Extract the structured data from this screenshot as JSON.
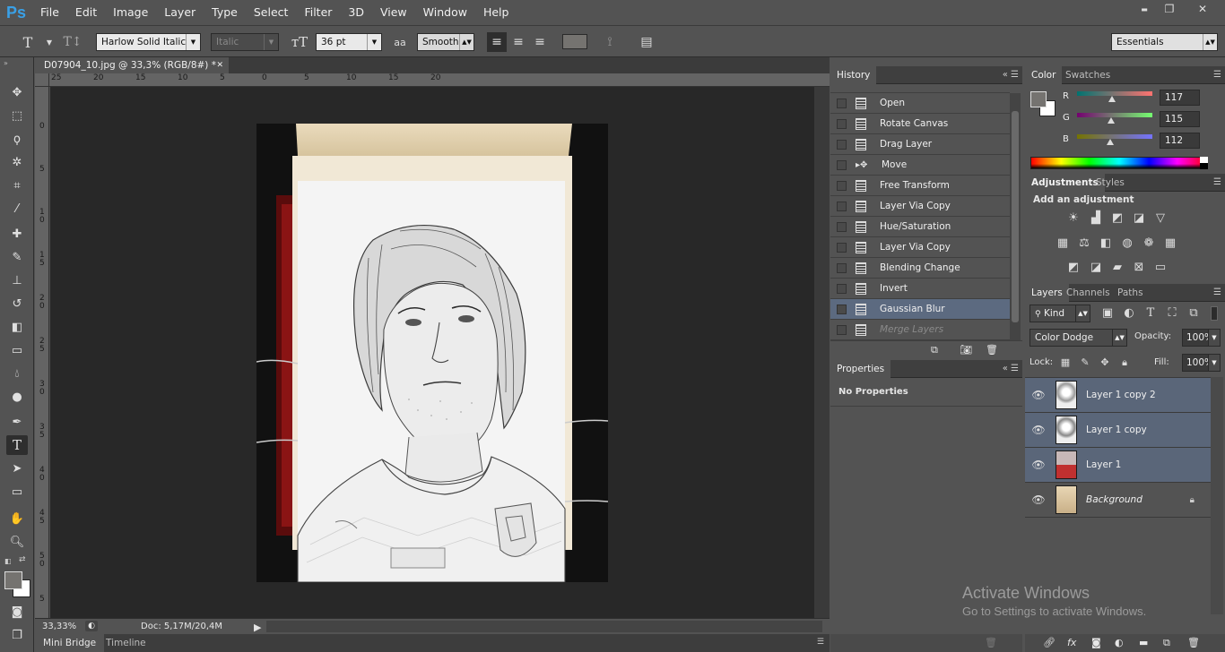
{
  "app": {
    "logo": "Ps"
  },
  "menu": [
    "File",
    "Edit",
    "Image",
    "Layer",
    "Type",
    "Select",
    "Filter",
    "3D",
    "View",
    "Window",
    "Help"
  ],
  "window_controls": {
    "minimize": "▬",
    "restore": "❐",
    "close": "✕"
  },
  "options_bar": {
    "font_family": "Harlow Solid Italic",
    "font_style": "Italic",
    "font_size": "36 pt",
    "aa_label": "aa",
    "antialias": "Smooth",
    "workspace": "Essentials"
  },
  "document": {
    "tab_title": "D07904_10.jpg @ 33,3% (RGB/8#) *",
    "close": "✕"
  },
  "ruler_h": [
    "25",
    "20",
    "15",
    "10",
    "5",
    "0",
    "5",
    "10",
    "15",
    "20"
  ],
  "ruler_v": [
    "0",
    "5",
    "1\n0",
    "1\n5",
    "2\n0",
    "2\n5",
    "3\n0",
    "3\n5",
    "4\n0",
    "4\n5",
    "5\n0",
    "5"
  ],
  "status": {
    "zoom": "33,33%",
    "doc": "Doc: 5,17M/20,4M"
  },
  "bottom_tabs": [
    "Mini Bridge",
    "Timeline"
  ],
  "history": {
    "tab": "History",
    "items": [
      {
        "label": "Open",
        "icon": "doc-icon"
      },
      {
        "label": "Rotate Canvas",
        "icon": "doc-icon"
      },
      {
        "label": "Drag Layer",
        "icon": "doc-icon"
      },
      {
        "label": "Move",
        "icon": "move-icon"
      },
      {
        "label": "Free Transform",
        "icon": "doc-icon"
      },
      {
        "label": "Layer Via Copy",
        "icon": "doc-icon"
      },
      {
        "label": "Hue/Saturation",
        "icon": "doc-icon"
      },
      {
        "label": "Layer Via Copy",
        "icon": "doc-icon"
      },
      {
        "label": "Blending Change",
        "icon": "doc-icon"
      },
      {
        "label": "Invert",
        "icon": "doc-icon"
      },
      {
        "label": "Gaussian Blur",
        "icon": "doc-icon",
        "selected": true
      },
      {
        "label": "Merge Layers",
        "icon": "doc-icon",
        "greyed": true
      }
    ]
  },
  "properties": {
    "tab": "Properties",
    "message": "No Properties"
  },
  "color_panel": {
    "tabs": [
      "Color",
      "Swatches"
    ],
    "channels": [
      {
        "label": "R",
        "value": "117"
      },
      {
        "label": "G",
        "value": "115"
      },
      {
        "label": "B",
        "value": "112"
      }
    ],
    "foreground": "#757370"
  },
  "adjustments": {
    "tabs": [
      "Adjustments",
      "Styles"
    ],
    "heading": "Add an adjustment"
  },
  "layers_panel": {
    "tabs": [
      "Layers",
      "Channels",
      "Paths"
    ],
    "kind": "Kind",
    "blend_mode": "Color Dodge",
    "opacity_label": "Opacity:",
    "opacity": "100%",
    "lock_label": "Lock:",
    "fill_label": "Fill:",
    "fill": "100%",
    "layers": [
      {
        "name": "Layer 1 copy 2",
        "selected": true
      },
      {
        "name": "Layer 1 copy",
        "selected": true
      },
      {
        "name": "Layer 1",
        "selected": true
      },
      {
        "name": "Background",
        "selected": false,
        "locked": true
      }
    ]
  },
  "watermark": {
    "title": "Activate Windows",
    "subtitle": "Go to Settings to activate Windows."
  }
}
